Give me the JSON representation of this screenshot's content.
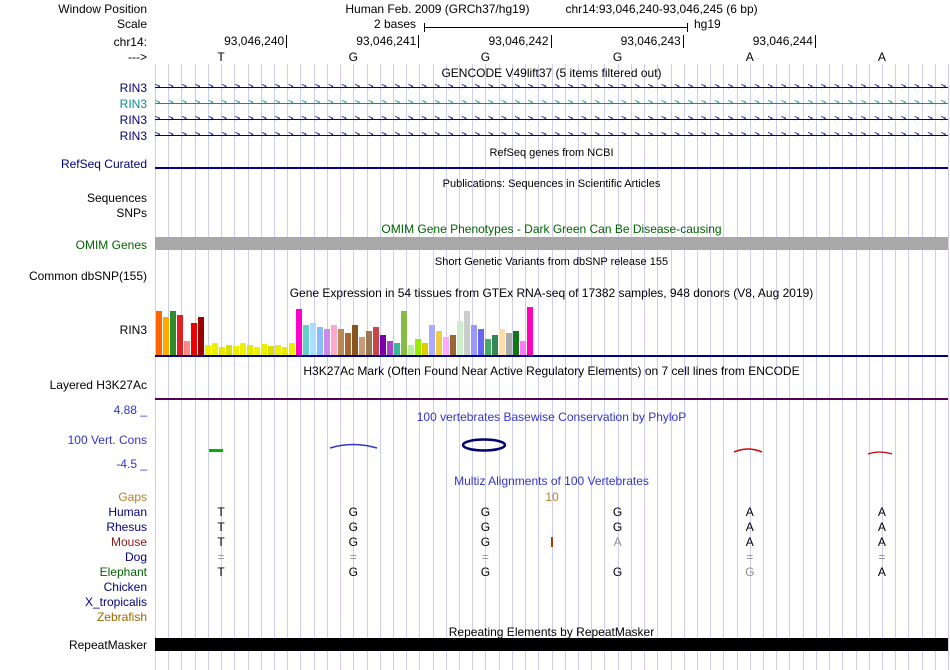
{
  "header": {
    "window_position_label": "Window Position",
    "assembly": "Human Feb. 2009 (GRCh37/hg19)",
    "position": "chr14:93,046,240-93,046,245 (6 bp)",
    "scale_label": "Scale",
    "scale_value": "2 bases",
    "scale_assembly": "hg19",
    "chrom_label": "chr14:",
    "strand_label": "--->",
    "coords": [
      "93,046,240",
      "93,046,241",
      "93,046,242",
      "93,046,243",
      "93,046,244"
    ],
    "bases": [
      "T",
      "G",
      "G",
      "G",
      "A",
      "A"
    ]
  },
  "tracks": {
    "gencode": {
      "title": "GENCODE V49lift37 (5 items filtered out)",
      "items": [
        {
          "label": "RIN3",
          "color": "#000080"
        },
        {
          "label": "RIN3",
          "color": "#0e8f8f"
        },
        {
          "label": "RIN3",
          "color": "#000080"
        },
        {
          "label": "RIN3",
          "color": "#000080"
        }
      ]
    },
    "refseq": {
      "title": "RefSeq genes from NCBI",
      "label": "RefSeq Curated"
    },
    "publications": {
      "title": "Publications: Sequences in Scientific Articles",
      "labels": [
        "Sequences",
        "SNPs"
      ]
    },
    "omim": {
      "title": "OMIM Gene Phenotypes - Dark Green Can Be Disease-causing",
      "label": "OMIM Genes"
    },
    "dbsnp": {
      "title": "Short Genetic Variants from dbSNP release 155",
      "label": "Common dbSNP(155)"
    },
    "gtex": {
      "title": "Gene Expression in 54 tissues from GTEx RNA-seq of 17382 samples, 948 donors (V8, Aug 2019)",
      "label": "RIN3"
    },
    "h3k27ac": {
      "title": "H3K27Ac Mark (Often Found Near Active Regulatory Elements) on 7 cell lines from ENCODE",
      "label": "Layered H3K27Ac"
    },
    "conservation": {
      "title": "100 vertebrates Basewise Conservation by PhyloP",
      "label": "100 Vert. Cons",
      "max": "4.88 _",
      "min": "-4.5 _"
    },
    "multiz": {
      "title": "Multiz Alignments of 100 Vertebrates",
      "gaps_label": "Gaps",
      "gap_count": "10",
      "rows": [
        {
          "species": "Human",
          "color": "#000080",
          "cells": [
            "T",
            "G",
            "G",
            "G",
            "A",
            "A"
          ]
        },
        {
          "species": "Rhesus",
          "color": "#000080",
          "cells": [
            "T",
            "G",
            "G",
            "G",
            "A",
            "A"
          ]
        },
        {
          "species": "Mouse",
          "color": "#8b1a1a",
          "cells": [
            "T",
            "G",
            "G",
            "A",
            "A",
            "A"
          ],
          "gray": [
            3
          ],
          "insert_col": 3
        },
        {
          "species": "Dog",
          "color": "#000080",
          "cells": [
            "=",
            "=",
            "=",
            "",
            "=",
            "="
          ]
        },
        {
          "species": "Elephant",
          "color": "#006400",
          "cells": [
            "T",
            "G",
            "G",
            "G",
            "G",
            "A"
          ],
          "gray": [
            4
          ]
        },
        {
          "species": "Chicken",
          "color": "#000080",
          "cells": [
            "",
            "",
            "",
            "",
            "",
            ""
          ]
        },
        {
          "species": "X_tropicalis",
          "color": "#000080",
          "cells": [
            "",
            "",
            "",
            "",
            "",
            ""
          ]
        },
        {
          "species": "Zebrafish",
          "color": "#996600",
          "cells": [
            "",
            "",
            "",
            "",
            "",
            ""
          ]
        }
      ]
    },
    "repeatmasker": {
      "title": "Repeating Elements by RepeatMasker",
      "label": "RepeatMasker"
    }
  },
  "colors": {
    "navy": "#000080",
    "teal": "#0e8f8f",
    "title_blue": "#3333cc",
    "omim_green": "#006400",
    "gaps_orange": "#bc7c28",
    "grid_line": "#cdcdf0",
    "omim_bar": "#a8a8a8",
    "h3k27ac_line": "#550055",
    "repeat_bar": "#000000",
    "insertion_mark": "#a04000",
    "gray_base": "#909090"
  },
  "chart_data": {
    "type": "bar",
    "title": "Gene Expression in 54 tissues from GTEx RNA-seq of 17382 samples, 948 donors (V8, Aug 2019)",
    "gene": "RIN3",
    "n_tissues": 54,
    "values_unit": "relative expression (pixel height, est.)",
    "bars": [
      [
        "#ff6600",
        44
      ],
      [
        "#ffaa00",
        38
      ],
      [
        "#2e8b2e",
        44
      ],
      [
        "#dd2222",
        40
      ],
      [
        "#ff8888",
        14
      ],
      [
        "#ee0000",
        32
      ],
      [
        "#990000",
        38
      ],
      [
        "#eeee00",
        10
      ],
      [
        "#eeee00",
        12
      ],
      [
        "#e8e800",
        8
      ],
      [
        "#dddd00",
        10
      ],
      [
        "#eeee00",
        9
      ],
      [
        "#eeee00",
        12
      ],
      [
        "#e8e800",
        10
      ],
      [
        "#eeee00",
        8
      ],
      [
        "#eeee00",
        11
      ],
      [
        "#dddd00",
        9
      ],
      [
        "#eeee00",
        10
      ],
      [
        "#e8e800",
        8
      ],
      [
        "#eeee00",
        12
      ],
      [
        "#ff00cc",
        46
      ],
      [
        "#66cccc",
        30
      ],
      [
        "#aaddff",
        32
      ],
      [
        "#88bbff",
        28
      ],
      [
        "#cc88ee",
        26
      ],
      [
        "#ffaacc",
        30
      ],
      [
        "#bb8855",
        26
      ],
      [
        "#aa6633",
        22
      ],
      [
        "#885522",
        30
      ],
      [
        "#cc9977",
        18
      ],
      [
        "#9b7653",
        24
      ],
      [
        "#cc4444",
        28
      ],
      [
        "#7700aa",
        20
      ],
      [
        "#aa44cc",
        14
      ],
      [
        "#33bb99",
        12
      ],
      [
        "#88bb44",
        44
      ],
      [
        "#bbee99",
        10
      ],
      [
        "#99ee00",
        16
      ],
      [
        "#ddcc00",
        12
      ],
      [
        "#aaaaff",
        30
      ],
      [
        "#eecc44",
        24
      ],
      [
        "#ffaaff",
        18
      ],
      [
        "#996633",
        20
      ],
      [
        "#cceecc",
        34
      ],
      [
        "#cccccc",
        44
      ],
      [
        "#9999ff",
        30
      ],
      [
        "#6666ee",
        26
      ],
      [
        "#44aa66",
        16
      ],
      [
        "#338855",
        20
      ],
      [
        "#ffddaa",
        26
      ],
      [
        "#aaaaaa",
        22
      ],
      [
        "#117711",
        24
      ],
      [
        "#ff77ff",
        14
      ],
      [
        "#ff00bb",
        48
      ]
    ]
  }
}
